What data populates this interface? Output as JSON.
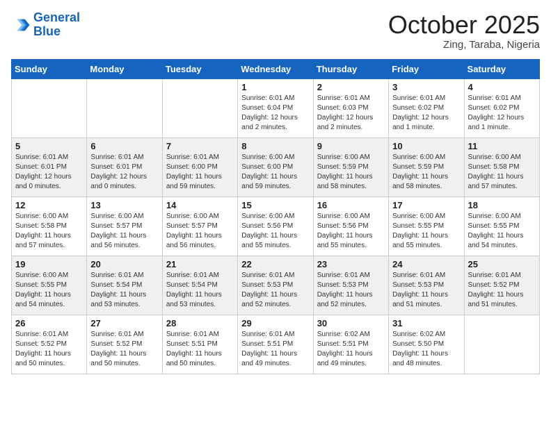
{
  "header": {
    "logo_line1": "General",
    "logo_line2": "Blue",
    "month": "October 2025",
    "location": "Zing, Taraba, Nigeria"
  },
  "days_of_week": [
    "Sunday",
    "Monday",
    "Tuesday",
    "Wednesday",
    "Thursday",
    "Friday",
    "Saturday"
  ],
  "weeks": [
    {
      "shaded": false,
      "days": [
        {
          "num": "",
          "info": ""
        },
        {
          "num": "",
          "info": ""
        },
        {
          "num": "",
          "info": ""
        },
        {
          "num": "1",
          "info": "Sunrise: 6:01 AM\nSunset: 6:04 PM\nDaylight: 12 hours\nand 2 minutes."
        },
        {
          "num": "2",
          "info": "Sunrise: 6:01 AM\nSunset: 6:03 PM\nDaylight: 12 hours\nand 2 minutes."
        },
        {
          "num": "3",
          "info": "Sunrise: 6:01 AM\nSunset: 6:02 PM\nDaylight: 12 hours\nand 1 minute."
        },
        {
          "num": "4",
          "info": "Sunrise: 6:01 AM\nSunset: 6:02 PM\nDaylight: 12 hours\nand 1 minute."
        }
      ]
    },
    {
      "shaded": true,
      "days": [
        {
          "num": "5",
          "info": "Sunrise: 6:01 AM\nSunset: 6:01 PM\nDaylight: 12 hours\nand 0 minutes."
        },
        {
          "num": "6",
          "info": "Sunrise: 6:01 AM\nSunset: 6:01 PM\nDaylight: 12 hours\nand 0 minutes."
        },
        {
          "num": "7",
          "info": "Sunrise: 6:01 AM\nSunset: 6:00 PM\nDaylight: 11 hours\nand 59 minutes."
        },
        {
          "num": "8",
          "info": "Sunrise: 6:00 AM\nSunset: 6:00 PM\nDaylight: 11 hours\nand 59 minutes."
        },
        {
          "num": "9",
          "info": "Sunrise: 6:00 AM\nSunset: 5:59 PM\nDaylight: 11 hours\nand 58 minutes."
        },
        {
          "num": "10",
          "info": "Sunrise: 6:00 AM\nSunset: 5:59 PM\nDaylight: 11 hours\nand 58 minutes."
        },
        {
          "num": "11",
          "info": "Sunrise: 6:00 AM\nSunset: 5:58 PM\nDaylight: 11 hours\nand 57 minutes."
        }
      ]
    },
    {
      "shaded": false,
      "days": [
        {
          "num": "12",
          "info": "Sunrise: 6:00 AM\nSunset: 5:58 PM\nDaylight: 11 hours\nand 57 minutes."
        },
        {
          "num": "13",
          "info": "Sunrise: 6:00 AM\nSunset: 5:57 PM\nDaylight: 11 hours\nand 56 minutes."
        },
        {
          "num": "14",
          "info": "Sunrise: 6:00 AM\nSunset: 5:57 PM\nDaylight: 11 hours\nand 56 minutes."
        },
        {
          "num": "15",
          "info": "Sunrise: 6:00 AM\nSunset: 5:56 PM\nDaylight: 11 hours\nand 55 minutes."
        },
        {
          "num": "16",
          "info": "Sunrise: 6:00 AM\nSunset: 5:56 PM\nDaylight: 11 hours\nand 55 minutes."
        },
        {
          "num": "17",
          "info": "Sunrise: 6:00 AM\nSunset: 5:55 PM\nDaylight: 11 hours\nand 55 minutes."
        },
        {
          "num": "18",
          "info": "Sunrise: 6:00 AM\nSunset: 5:55 PM\nDaylight: 11 hours\nand 54 minutes."
        }
      ]
    },
    {
      "shaded": true,
      "days": [
        {
          "num": "19",
          "info": "Sunrise: 6:00 AM\nSunset: 5:55 PM\nDaylight: 11 hours\nand 54 minutes."
        },
        {
          "num": "20",
          "info": "Sunrise: 6:01 AM\nSunset: 5:54 PM\nDaylight: 11 hours\nand 53 minutes."
        },
        {
          "num": "21",
          "info": "Sunrise: 6:01 AM\nSunset: 5:54 PM\nDaylight: 11 hours\nand 53 minutes."
        },
        {
          "num": "22",
          "info": "Sunrise: 6:01 AM\nSunset: 5:53 PM\nDaylight: 11 hours\nand 52 minutes."
        },
        {
          "num": "23",
          "info": "Sunrise: 6:01 AM\nSunset: 5:53 PM\nDaylight: 11 hours\nand 52 minutes."
        },
        {
          "num": "24",
          "info": "Sunrise: 6:01 AM\nSunset: 5:53 PM\nDaylight: 11 hours\nand 51 minutes."
        },
        {
          "num": "25",
          "info": "Sunrise: 6:01 AM\nSunset: 5:52 PM\nDaylight: 11 hours\nand 51 minutes."
        }
      ]
    },
    {
      "shaded": false,
      "days": [
        {
          "num": "26",
          "info": "Sunrise: 6:01 AM\nSunset: 5:52 PM\nDaylight: 11 hours\nand 50 minutes."
        },
        {
          "num": "27",
          "info": "Sunrise: 6:01 AM\nSunset: 5:52 PM\nDaylight: 11 hours\nand 50 minutes."
        },
        {
          "num": "28",
          "info": "Sunrise: 6:01 AM\nSunset: 5:51 PM\nDaylight: 11 hours\nand 50 minutes."
        },
        {
          "num": "29",
          "info": "Sunrise: 6:01 AM\nSunset: 5:51 PM\nDaylight: 11 hours\nand 49 minutes."
        },
        {
          "num": "30",
          "info": "Sunrise: 6:02 AM\nSunset: 5:51 PM\nDaylight: 11 hours\nand 49 minutes."
        },
        {
          "num": "31",
          "info": "Sunrise: 6:02 AM\nSunset: 5:50 PM\nDaylight: 11 hours\nand 48 minutes."
        },
        {
          "num": "",
          "info": ""
        }
      ]
    }
  ]
}
